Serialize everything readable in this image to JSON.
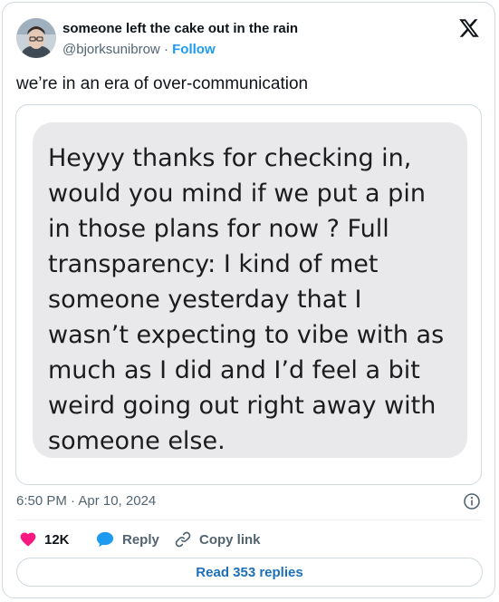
{
  "author": {
    "display_name": "someone left the cake out in the rain",
    "handle": "@bjorksunibrow",
    "separator": " · ",
    "follow_label": "Follow"
  },
  "tweet": {
    "text": "we’re in an era of over-communication",
    "timestamp": "6:50 PM · Apr 10, 2024"
  },
  "message_bubble": {
    "text": "Heyyy thanks for checking in,\nwould you mind if we put a pin\nin those plans for now ? Full\ntransparency: I kind of met\nsomeone yesterday that I\nwasn’t expecting to vibe with as\nmuch as I did and I’d feel a bit\nweird going out right away with\nsomeone else."
  },
  "actions": {
    "like_count": "12K",
    "reply_label": "Reply",
    "copy_link_label": "Copy link",
    "read_replies_label": "Read 353 replies"
  },
  "icons": {
    "platform_logo": "x-logo-icon",
    "info": "info-icon",
    "like": "heart-icon",
    "reply": "speech-bubble-icon",
    "copy_link": "link-icon"
  },
  "colors": {
    "like_red": "#f91880",
    "reply_blue": "#1d9bf0",
    "link_blue": "#1d9bf0",
    "read_replies_blue": "#1d6fb8",
    "bubble_gray": "#e9e9eb"
  }
}
